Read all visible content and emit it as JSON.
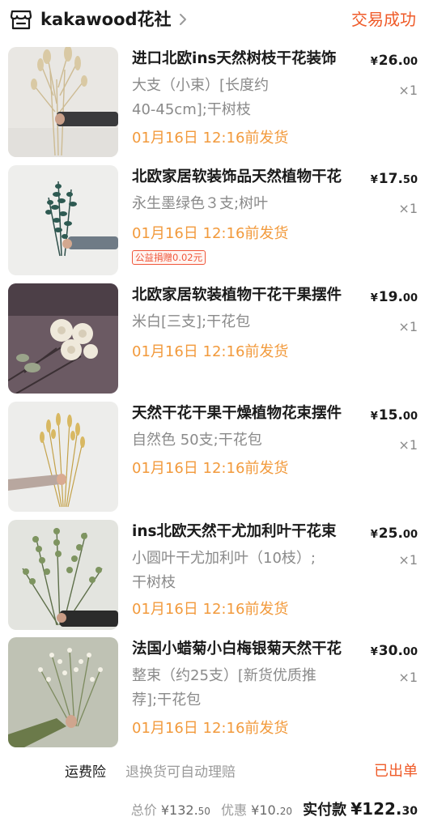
{
  "header": {
    "store_name": "kakawood花社",
    "status": "交易成功"
  },
  "items": [
    {
      "title": "进口北欧ins天然树枝干花装饰",
      "price_currency": "¥",
      "price_int": "26.",
      "price_dec": "00",
      "spec_line1": "大支（小束）[长度约",
      "spec_line2": "40-45cm];干树枝",
      "qty": "×1",
      "ship": "01月16日 12:16前发货"
    },
    {
      "title": "北欧家居软装饰品天然植物干花",
      "price_currency": "¥",
      "price_int": "17.",
      "price_dec": "50",
      "spec_line1": "永生墨绿色３支;树叶",
      "qty": "×1",
      "ship": "01月16日 12:16前发货",
      "badge": "公益捐赠0.02元"
    },
    {
      "title": "北欧家居软装植物干花干果摆件",
      "price_currency": "¥",
      "price_int": "19.",
      "price_dec": "00",
      "spec_line1": "米白[三支];干花包",
      "qty": "×1",
      "ship": "01月16日 12:16前发货"
    },
    {
      "title": "天然干花干果干燥植物花束摆件",
      "price_currency": "¥",
      "price_int": "15.",
      "price_dec": "00",
      "spec_line1": "自然色 50支;干花包",
      "qty": "×1",
      "ship": "01月16日 12:16前发货"
    },
    {
      "title": "ins北欧天然干尤加利叶干花束",
      "price_currency": "¥",
      "price_int": "25.",
      "price_dec": "00",
      "spec_line1": "小圆叶干尤加利叶（10枝）;",
      "spec_line2": "干树枝",
      "qty": "×1",
      "ship": "01月16日 12:16前发货"
    },
    {
      "title": "法国小蜡菊小白梅银菊天然干花",
      "price_currency": "¥",
      "price_int": "30.",
      "price_dec": "00",
      "spec_line1": "整束（约25支）[新货优质推",
      "spec_line2": "荐];干花包",
      "qty": "×1",
      "ship": "01月16日 12:16前发货"
    }
  ],
  "insurance": {
    "label": "运费险",
    "description": "退换货可自动理赔",
    "status": "已出单"
  },
  "totals": {
    "total_label": "总价",
    "total_int": "¥132.",
    "total_dec": "50",
    "discount_label": "优惠",
    "discount_int": "¥10.",
    "discount_dec": "20",
    "paid_label": "实付款",
    "paid_int": "¥122.",
    "paid_dec": "30"
  },
  "colors": {
    "status_orange": "#ef5a28",
    "ship_orange": "#f29a3c",
    "gray_text": "#8a8a8a"
  },
  "icons": [
    "store-icon",
    "chevron-right-icon"
  ]
}
